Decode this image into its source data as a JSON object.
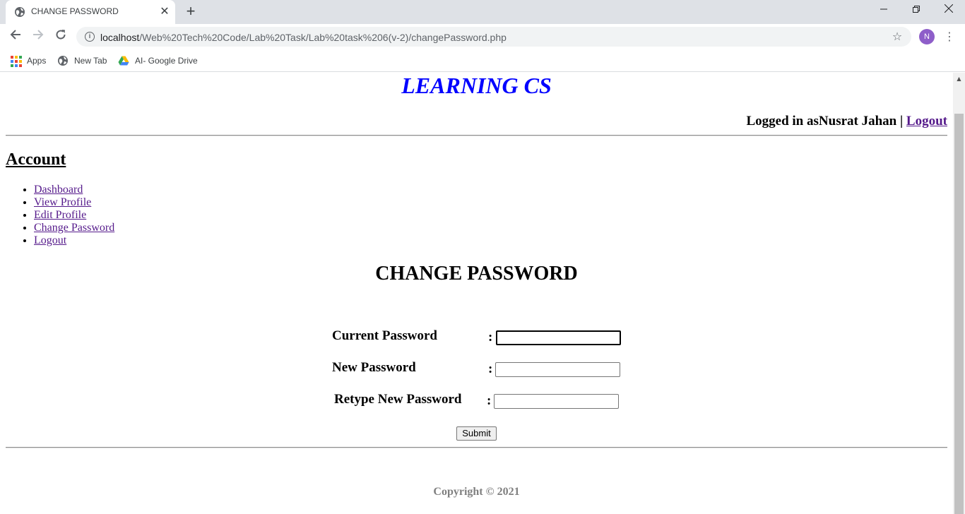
{
  "browser": {
    "tab_title": "CHANGE PASSWORD",
    "tab_close": "✕",
    "new_tab": "+",
    "url_host": "localhost",
    "url_path": "/Web%20Tech%20Code/Lab%20Task/Lab%20task%206(v-2)/changePassword.php",
    "avatar_initial": "N",
    "bookmarks": [
      {
        "label": "Apps",
        "icon": "apps-grid-icon"
      },
      {
        "label": "New Tab",
        "icon": "globe-icon"
      },
      {
        "label": "AI- Google Drive",
        "icon": "google-drive-icon"
      }
    ],
    "colors": {
      "tabbar_bg": "#dee1e6",
      "avatar_bg": "#8e5ec9"
    }
  },
  "site": {
    "title": "LEARNING CS",
    "login_prefix": "Logged in as",
    "user_name": "Nusrat Jahan",
    "separator": " | ",
    "logout_label": "Logout",
    "title_color": "#0000ff"
  },
  "sidebar": {
    "heading": "Account",
    "items": [
      {
        "label": "Dashboard"
      },
      {
        "label": "View Profile"
      },
      {
        "label": "Edit Profile"
      },
      {
        "label": "Change Password"
      },
      {
        "label": "Logout"
      }
    ]
  },
  "form": {
    "title": "CHANGE PASSWORD",
    "colon": ":",
    "fields": [
      {
        "label": "Current Password",
        "value": ""
      },
      {
        "label": "New Password",
        "value": ""
      },
      {
        "label": "Retype New Password",
        "value": ""
      }
    ],
    "submit_label": "Submit"
  },
  "footer": {
    "copyright": "Copyright © 2021"
  }
}
